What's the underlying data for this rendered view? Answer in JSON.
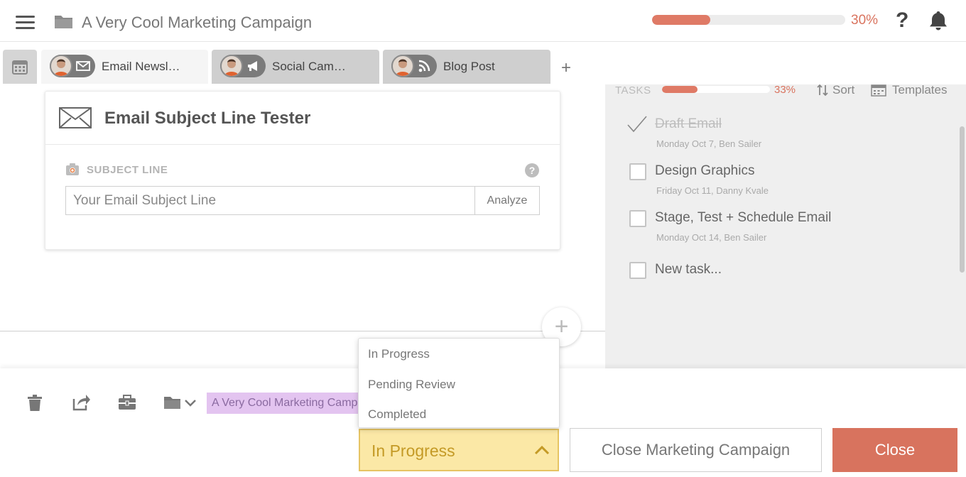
{
  "header": {
    "title": "A Very Cool Marketing Campaign",
    "progress_fraction": 0.3,
    "progress_label": "30%",
    "help_label": "?"
  },
  "tabs": [
    {
      "label": "Email Newsl…",
      "icon": "envelope-icon",
      "active": true
    },
    {
      "label": "Social Cam…",
      "icon": "megaphone-icon",
      "active": false
    },
    {
      "label": "Blog Post",
      "icon": "rss-icon",
      "active": false
    }
  ],
  "add_tab_label": "+",
  "tester": {
    "title": "Email Subject Line Tester",
    "field_label": "SUBJECT LINE",
    "help_label": "?",
    "placeholder": "Your Email Subject Line",
    "analyze_label": "Analyze"
  },
  "add_block_label": "+",
  "tasks": {
    "label": "TASKS",
    "progress_fraction": 0.33,
    "progress_label": "33%",
    "sort_label": "Sort",
    "templates_label": "Templates",
    "items": [
      {
        "name": "Draft Email",
        "meta": "Monday Oct 7,  Ben Sailer",
        "done": true
      },
      {
        "name": "Design Graphics",
        "meta": "Friday Oct 11,  Danny Kvale",
        "done": false
      },
      {
        "name": "Stage, Test + Schedule Email",
        "meta": "Monday Oct 14,  Ben Sailer",
        "done": false
      }
    ],
    "new_task_label": "New task..."
  },
  "bottom": {
    "campaign_tag": "A Very Cool Marketing Campaign",
    "status_value": "In Progress",
    "status_options": [
      "In Progress",
      "Pending Review",
      "Completed"
    ],
    "close_campaign_label": "Close Marketing Campaign",
    "close_label": "Close"
  },
  "colors": {
    "accent": "#d8735e",
    "status_bg": "#fbe8a6",
    "status_text": "#c49a26",
    "tag_bg": "#e3c4f0"
  }
}
